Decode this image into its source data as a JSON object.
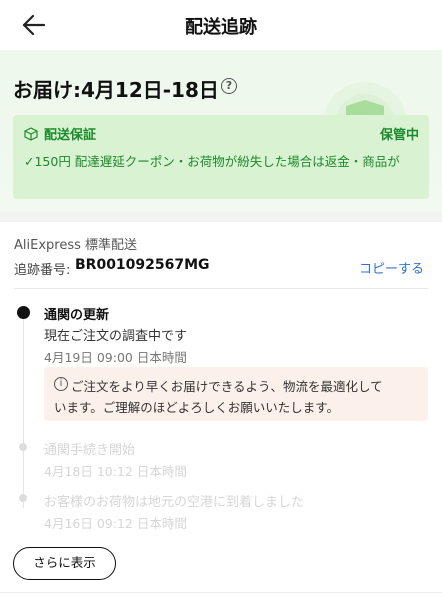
{
  "header": {
    "title": "配送追跡",
    "back_icon": "arrow-left-icon"
  },
  "hero": {
    "eta_label": "お届け:4月12日-18日",
    "info_icon": "question-circle-icon",
    "decoration_icon": "shield-check-icon",
    "guarantee": {
      "title": "配送保証",
      "status": "保管中",
      "description": "✓150円 配達遅延クーポン・お荷物が紛失した場合は返金・商品が",
      "icon": "package-icon"
    }
  },
  "shipment": {
    "carrier": "AliExpress 標準配送",
    "tracking_label": "追跡番号:",
    "tracking_number": "BR001092567MG",
    "copy_label": "コピーする"
  },
  "events": [
    {
      "title": "通関の更新",
      "text": "現在ご注文の調査中です",
      "time": "4月19日 09:00 日本時間"
    },
    {
      "title": "通関手続き開始",
      "time": "4月18日 10:12 日本時間"
    },
    {
      "title": "お客様のお荷物は地元の空港に到着しました",
      "time": "4月16日 09:12 日本時間"
    }
  ],
  "notice": {
    "line1": "ご注文をより早くお届けできるよう、物流を最適化して",
    "line2": "います。ご理解のほどよろしくお願いいたします。",
    "icon": "info-circle-icon"
  },
  "footer": {
    "more_label": "さらに表示"
  },
  "colors": {
    "accent_green": "#1a8a2a",
    "guarantee_bg": "#d9f2d2",
    "link_blue": "#2f6fd6",
    "notice_bg": "#fbf1ea"
  }
}
